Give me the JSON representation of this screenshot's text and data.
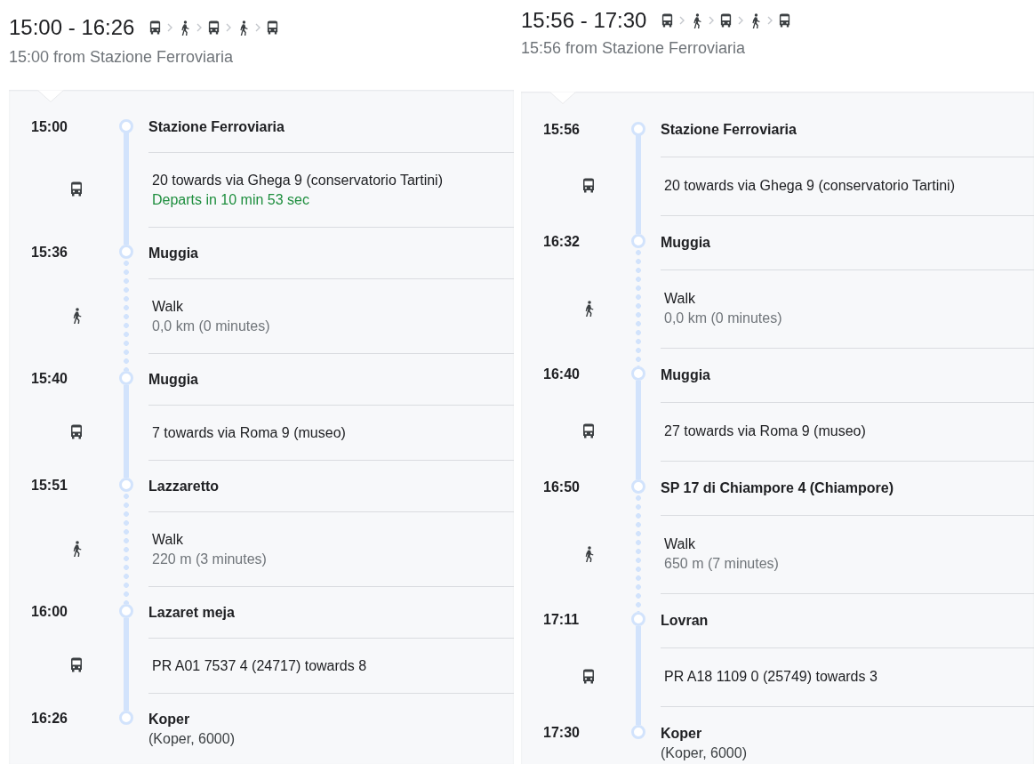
{
  "routes": [
    {
      "title": "15:00 - 16:26",
      "modes": [
        {
          "kind": "bus"
        },
        {
          "kind": "walk"
        },
        {
          "kind": "bus"
        },
        {
          "kind": "walk"
        },
        {
          "kind": "bus"
        }
      ],
      "subtitle": "15:00 from Stazione Ferroviaria",
      "steps": [
        {
          "kind": "stop",
          "time": "15:00",
          "name": "Stazione Ferroviaria"
        },
        {
          "kind": "bus",
          "text": "20 towards via Ghega 9 (conservatorio Tartini)",
          "status": "Departs in 10 min 53 sec"
        },
        {
          "kind": "stop",
          "time": "15:36",
          "name": "Muggia"
        },
        {
          "kind": "walk",
          "text": "Walk",
          "detail": "0,0 km (0 minutes)"
        },
        {
          "kind": "stop",
          "time": "15:40",
          "name": "Muggia"
        },
        {
          "kind": "bus",
          "text": "7 towards via Roma 9 (museo)"
        },
        {
          "kind": "stop",
          "time": "15:51",
          "name": "Lazzaretto"
        },
        {
          "kind": "walk",
          "text": "Walk",
          "detail": "220 m (3 minutes)"
        },
        {
          "kind": "stop",
          "time": "16:00",
          "name": "Lazaret meja"
        },
        {
          "kind": "bus",
          "text": "PR A01 7537 4 (24717) towards 8"
        },
        {
          "kind": "stop",
          "time": "16:26",
          "name": "Koper",
          "detail": "(Koper, 6000)"
        }
      ]
    },
    {
      "title": "15:56 - 17:30",
      "modes": [
        {
          "kind": "bus"
        },
        {
          "kind": "walk"
        },
        {
          "kind": "bus"
        },
        {
          "kind": "walk"
        },
        {
          "kind": "bus"
        }
      ],
      "subtitle": "15:56 from Stazione Ferroviaria",
      "steps": [
        {
          "kind": "stop",
          "time": "15:56",
          "name": "Stazione Ferroviaria"
        },
        {
          "kind": "bus",
          "text": "20 towards via Ghega 9 (conservatorio Tartini)"
        },
        {
          "kind": "stop",
          "time": "16:32",
          "name": "Muggia"
        },
        {
          "kind": "walk",
          "text": "Walk",
          "detail": "0,0 km (0 minutes)"
        },
        {
          "kind": "stop",
          "time": "16:40",
          "name": "Muggia"
        },
        {
          "kind": "bus",
          "text": "27 towards via Roma 9 (museo)"
        },
        {
          "kind": "stop",
          "time": "16:50",
          "name": "SP 17 di Chiampore 4 (Chiampore)"
        },
        {
          "kind": "walk",
          "text": "Walk",
          "detail": "650 m (7 minutes)"
        },
        {
          "kind": "stop",
          "time": "17:11",
          "name": "Lovran"
        },
        {
          "kind": "bus",
          "text": "PR A18 1109 0 (25749) towards 3"
        },
        {
          "kind": "stop",
          "time": "17:30",
          "name": "Koper",
          "detail": "(Koper, 6000)"
        }
      ]
    }
  ]
}
